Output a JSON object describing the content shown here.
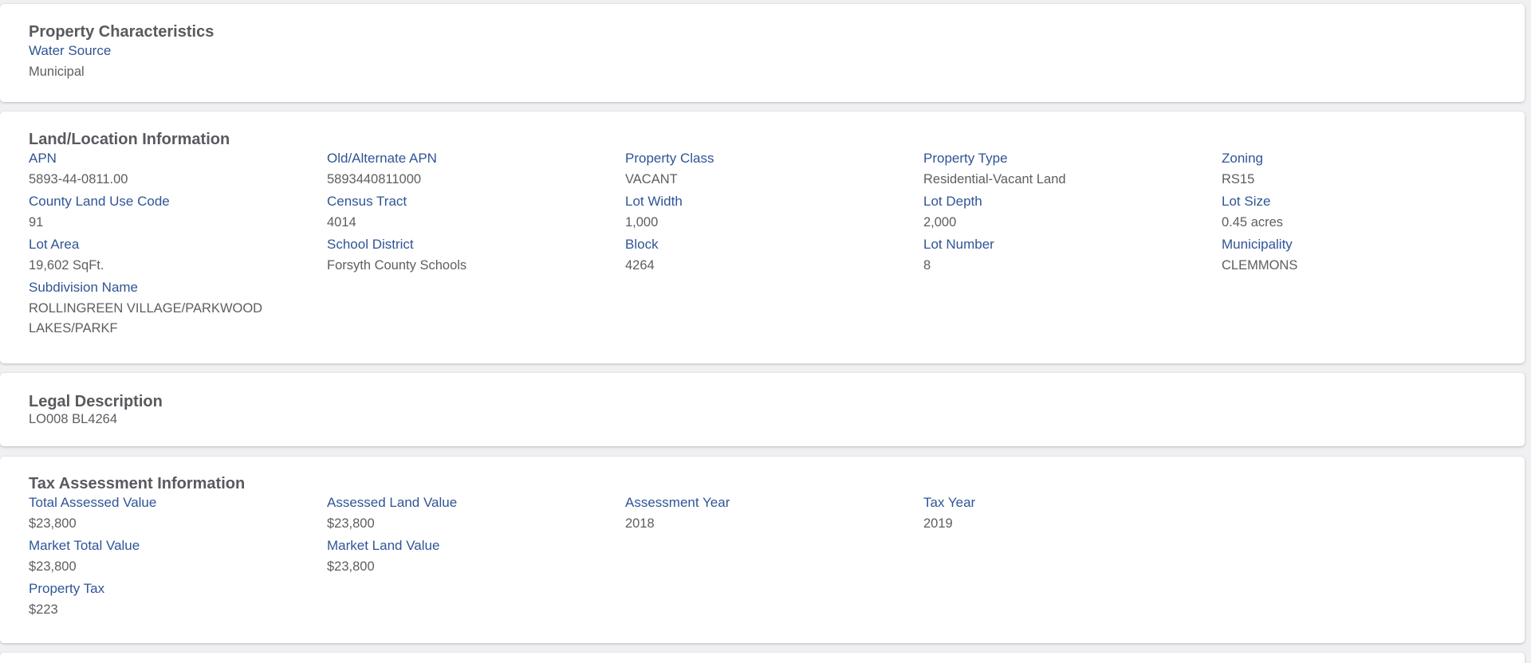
{
  "property_characteristics": {
    "title": "Property Characteristics",
    "fields": [
      {
        "label": "Water Source",
        "value": "Municipal"
      }
    ]
  },
  "land_location": {
    "title": "Land/Location Information",
    "fields": [
      {
        "label": "APN",
        "value": "5893-44-0811.00"
      },
      {
        "label": "Old/Alternate APN",
        "value": "5893440811000"
      },
      {
        "label": "Property Class",
        "value": "VACANT"
      },
      {
        "label": "Property Type",
        "value": "Residential-Vacant Land"
      },
      {
        "label": "Zoning",
        "value": "RS15"
      },
      {
        "label": "County Land Use Code",
        "value": "91"
      },
      {
        "label": "Census Tract",
        "value": "4014"
      },
      {
        "label": "Lot Width",
        "value": "1,000"
      },
      {
        "label": "Lot Depth",
        "value": "2,000"
      },
      {
        "label": "Lot Size",
        "value": "0.45 acres"
      },
      {
        "label": "Lot Area",
        "value": "19,602 SqFt."
      },
      {
        "label": "School District",
        "value": "Forsyth County Schools"
      },
      {
        "label": "Block",
        "value": "4264"
      },
      {
        "label": "Lot Number",
        "value": "8"
      },
      {
        "label": "Municipality",
        "value": "CLEMMONS"
      },
      {
        "label": "Subdivision Name",
        "value": "ROLLINGREEN VILLAGE/PARKWOOD LAKES/PARKF"
      }
    ]
  },
  "legal_description": {
    "title": "Legal Description",
    "value": "LO008 BL4264"
  },
  "tax_assessment": {
    "title": "Tax Assessment Information",
    "fields": [
      {
        "label": "Total Assessed Value",
        "value": "$23,800"
      },
      {
        "label": "Assessed Land Value",
        "value": "$23,800"
      },
      {
        "label": "Assessment Year",
        "value": "2018"
      },
      {
        "label": "Tax Year",
        "value": "2019"
      },
      {
        "label": "Market Total Value",
        "value": "$23,800"
      },
      {
        "label": "Market Land Value",
        "value": "$23,800"
      },
      {
        "label": "Property Tax",
        "value": "$223"
      }
    ]
  }
}
